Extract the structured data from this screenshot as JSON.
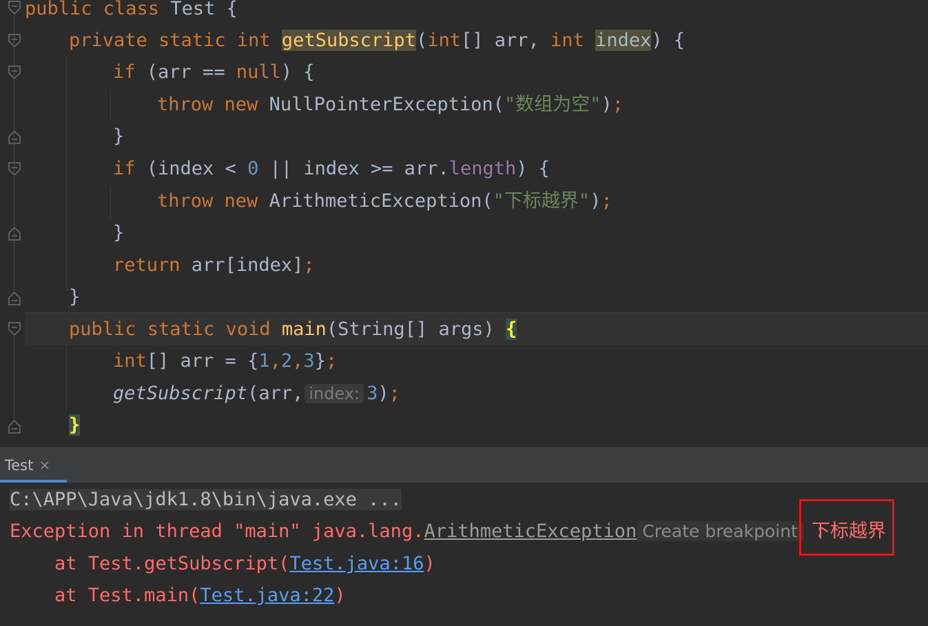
{
  "editor": {
    "lines": {
      "l1": {
        "kw1": "public class ",
        "rest": "Test {"
      },
      "l2": {
        "kw1": "private static int ",
        "method": "getSubscript",
        "p1": "(",
        "kw2": "int",
        "p2": "[] arr, ",
        "kw3": "int",
        "p3": " ",
        "param": "index",
        "p4": ") {"
      },
      "l3": {
        "kw1": "if ",
        "p1": "(arr == ",
        "kw2": "null",
        "p2": ") {"
      },
      "l4": {
        "kw1": "throw new ",
        "cls": "NullPointerException(",
        "str": "\"数组为空\"",
        "p1": ")",
        "semi": ";"
      },
      "l5": {
        "brace": "}"
      },
      "l6": {
        "kw1": "if ",
        "p1": "(index < ",
        "num": "0",
        "p2": " || index >= arr.",
        "field": "length",
        "p3": ") {"
      },
      "l7": {
        "kw1": "throw new ",
        "cls": "ArithmeticException(",
        "str": "\"下标越界\"",
        "p1": ")",
        "semi": ";"
      },
      "l8": {
        "brace": "}"
      },
      "l9": {
        "kw1": "return ",
        "p1": "arr[index]",
        "semi": ";"
      },
      "l10": {
        "brace": "}"
      },
      "l11": {
        "kw1": "public static void ",
        "method": "main",
        "p1": "(String[] args) ",
        "brace": "{"
      },
      "l12": {
        "kw1": "int",
        "p1": "[] arr = {",
        "n1": "1",
        "c1": ",",
        "n2": "2",
        "c2": ",",
        "n3": "3",
        "p2": "}",
        "semi": ";"
      },
      "l13": {
        "method": "getSubscript",
        "p1": "(arr,",
        "hint": "index:",
        "num": "3",
        "p2": ")",
        "semi": ";"
      },
      "l14": {
        "brace": "}"
      }
    }
  },
  "run_panel": {
    "tab_label": "Test",
    "console": {
      "command": "C:\\APP\\Java\\jdk1.8\\bin\\java.exe ...",
      "exception_prefix": "Exception in thread \"main\" java.lang.",
      "exception_class": "ArithmeticException",
      "breakpoint_hint": "Create breakpoint",
      "colon": " :",
      "message": "下标越界",
      "frames": [
        {
          "prefix": "    at Test.getSubscript(",
          "link": "Test.java:16",
          "suffix": ")"
        },
        {
          "prefix": "    at Test.main(",
          "link": "Test.java:22",
          "suffix": ")"
        }
      ]
    }
  },
  "colors": {
    "background": "#2b2b2b",
    "keyword": "#cc7832",
    "method": "#ffc66d",
    "string": "#6a8759",
    "number": "#6897bb",
    "error_text": "#ff6b68",
    "link": "#589df6",
    "highlight_box": "#e8131b"
  },
  "icons": {
    "fold_markers": "fold-icon",
    "tab_close": "close-icon"
  }
}
